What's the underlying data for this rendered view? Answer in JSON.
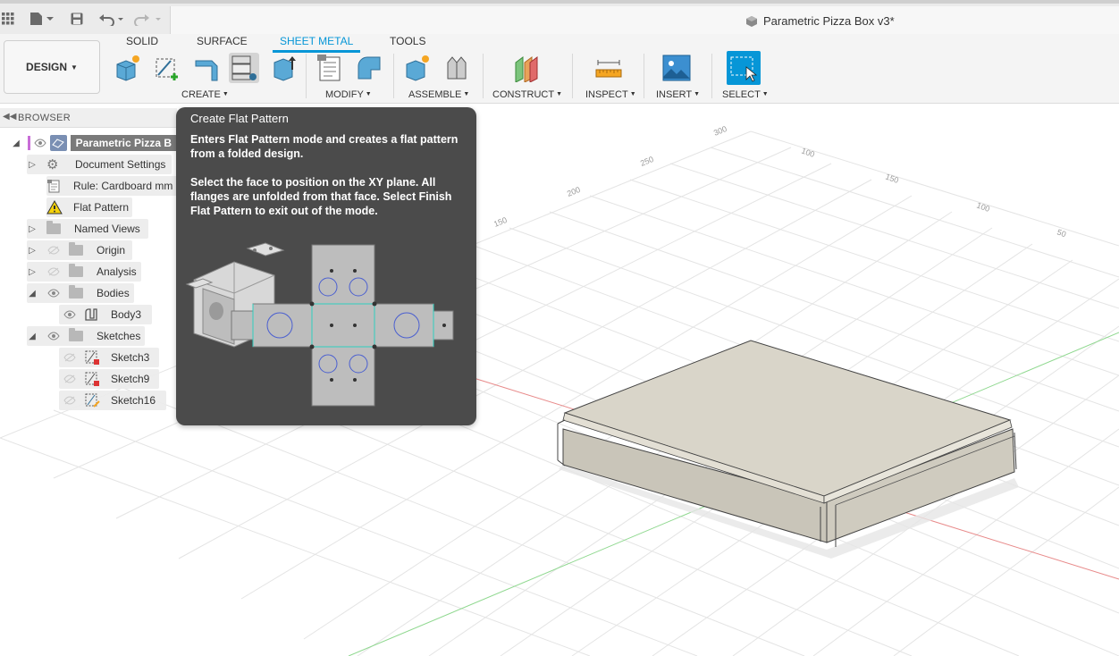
{
  "window": {
    "title": "Parametric Pizza Box v3*"
  },
  "toolbar": {
    "workspace_label": "DESIGN",
    "tabs": [
      {
        "label": "SOLID"
      },
      {
        "label": "SURFACE"
      },
      {
        "label": "SHEET METAL"
      },
      {
        "label": "TOOLS"
      }
    ],
    "active_tab": "SHEET METAL",
    "groups": [
      {
        "label": "CREATE"
      },
      {
        "label": "MODIFY"
      },
      {
        "label": "ASSEMBLE"
      },
      {
        "label": "CONSTRUCT"
      },
      {
        "label": "INSPECT"
      },
      {
        "label": "INSERT"
      },
      {
        "label": "SELECT"
      }
    ]
  },
  "browser": {
    "header": "BROWSER",
    "nodes": [
      {
        "label": "Parametric Pizza B"
      },
      {
        "label": "Document Settings"
      },
      {
        "label": "Rule: Cardboard mm"
      },
      {
        "label": "Flat Pattern"
      },
      {
        "label": "Named Views"
      },
      {
        "label": "Origin"
      },
      {
        "label": "Analysis"
      },
      {
        "label": "Bodies"
      },
      {
        "label": "Body3"
      },
      {
        "label": "Sketches"
      },
      {
        "label": "Sketch3"
      },
      {
        "label": "Sketch9"
      },
      {
        "label": "Sketch16"
      }
    ]
  },
  "tooltip": {
    "title": "Create Flat Pattern",
    "paragraph1": "Enters Flat Pattern mode and creates a flat pattern from a folded design.",
    "paragraph2": "Select the face to position on the XY plane. All flanges are unfolded from that face. Select Finish Flat Pattern to exit out of the mode."
  },
  "viewport": {
    "grid_labels": [
      "300",
      "250",
      "200",
      "150",
      "100",
      "150",
      "100",
      "50"
    ]
  },
  "colors": {
    "accent": "#0696d7",
    "tooltip_bg": "#4b4b4b",
    "model": "#d6d2c6",
    "x_axis": "#e88a8a",
    "y_axis": "#8fd88f"
  }
}
